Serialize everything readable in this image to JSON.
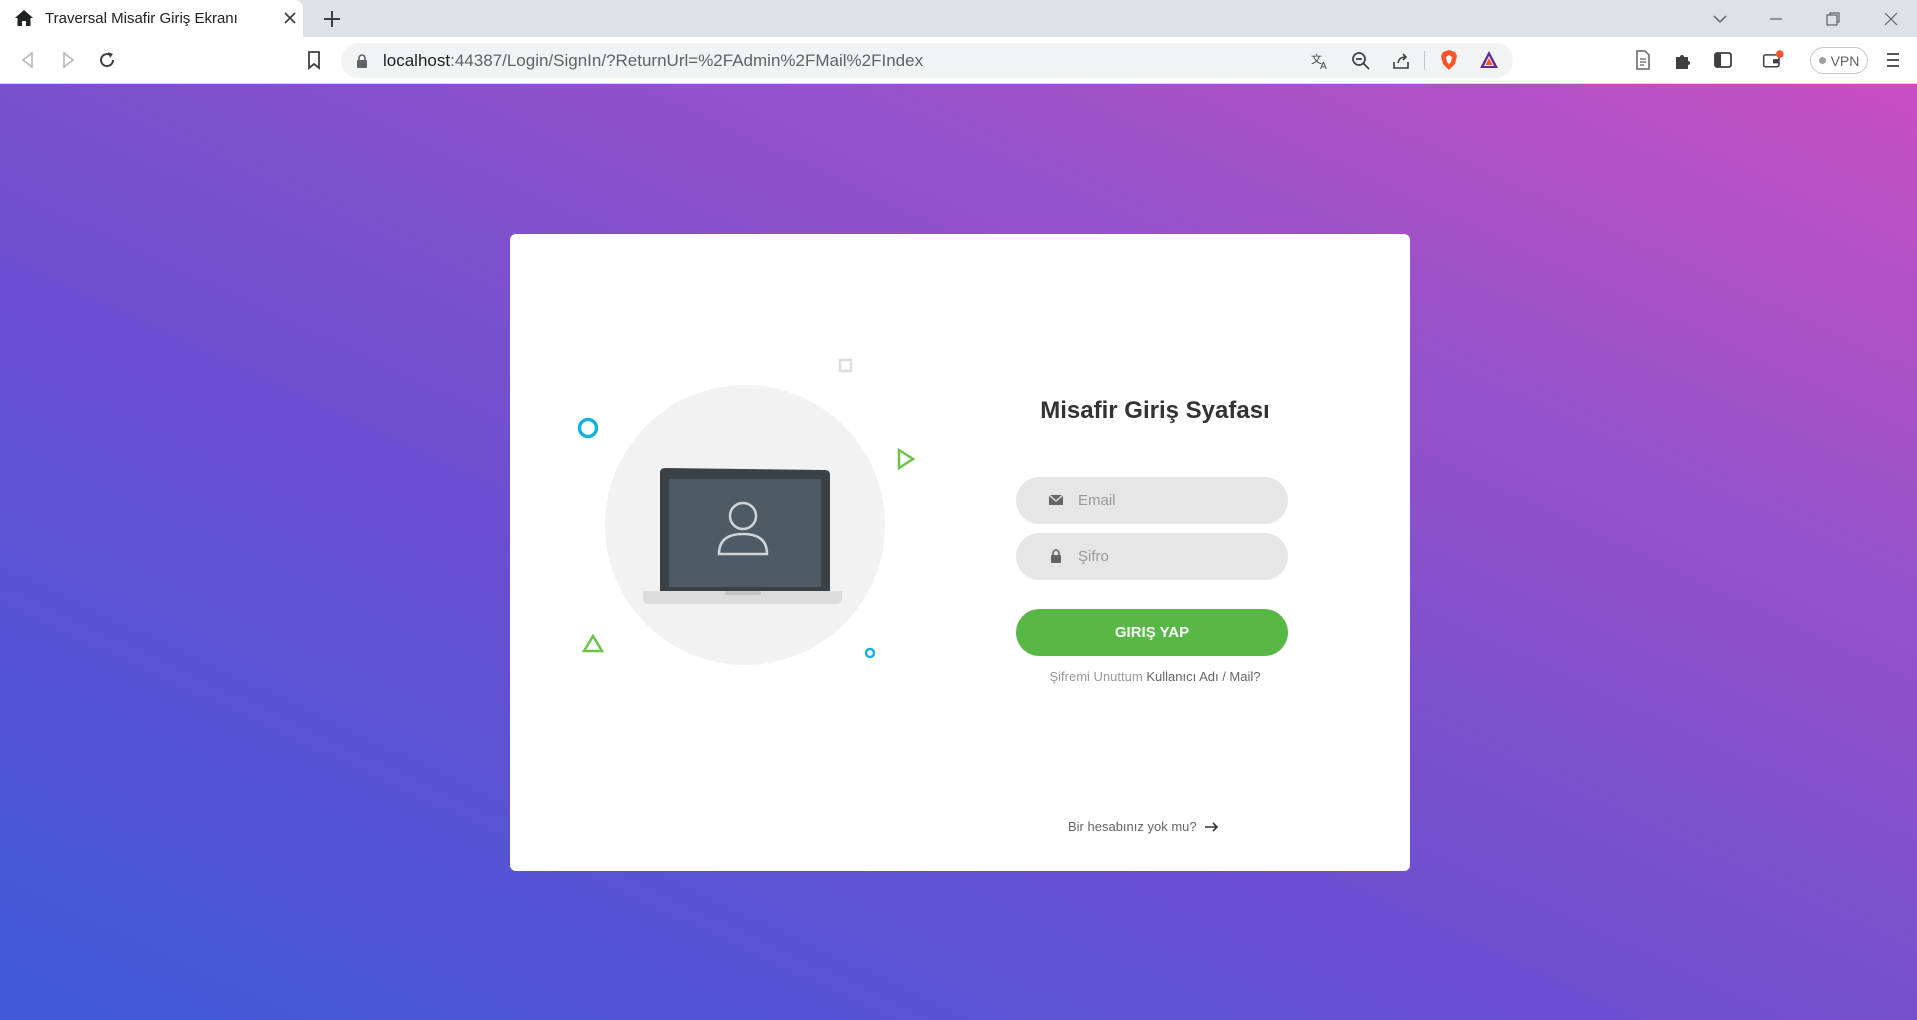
{
  "browser": {
    "tab_title": "Traversal Misafir Giriş Ekranı",
    "url_host": "localhost",
    "url_rest": ":44387/Login/SignIn/?ReturnUrl=%2FAdmin%2FMail%2FIndex",
    "vpn_label": "VPN",
    "accent_brave": "#fb542b"
  },
  "login": {
    "heading": "Misafir Giriş Syafası",
    "email_placeholder": "Email",
    "password_placeholder": "Şifro",
    "submit_label": "GIRIŞ YAP",
    "forgot_prefix": "Şifremi Unuttum",
    "forgot_link": "Kullanıcı Adı / Mail?",
    "signup_label": "Bir hesabınız yok mu?"
  },
  "colors": {
    "primary_button": "#57b846",
    "gradient_start": "#3f5ad8",
    "gradient_end": "#c84fc4",
    "decor_cyan": "#17b2e0",
    "decor_green": "#6cc24a"
  },
  "icons": {
    "email": "envelope-icon",
    "password": "lock-icon",
    "signup_arrow": "arrow-right-icon"
  }
}
